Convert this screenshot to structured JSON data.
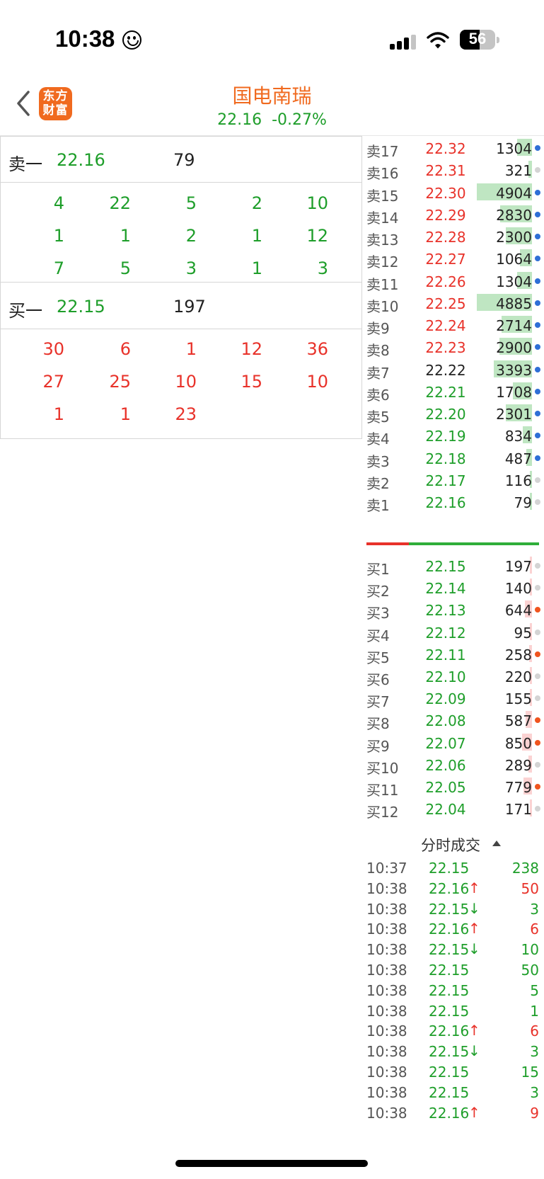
{
  "status_bar": {
    "time": "10:38",
    "battery": "56",
    "battery_level": 0.56,
    "signal_bars": 3
  },
  "header": {
    "logo_line1": "东方",
    "logo_line2": "财富",
    "stock_name": "国电南瑞",
    "price": "22.16",
    "change": "-0.27%"
  },
  "level1": {
    "ask": {
      "label": "卖一",
      "price": "22.16",
      "volume": "79"
    },
    "ask_queue": [
      [
        "4",
        "22",
        "5",
        "2",
        "10"
      ],
      [
        "1",
        "1",
        "2",
        "1",
        "12"
      ],
      [
        "7",
        "5",
        "3",
        "1",
        "3"
      ]
    ],
    "bid": {
      "label": "买一",
      "price": "22.15",
      "volume": "197"
    },
    "bid_queue": [
      [
        "30",
        "6",
        "1",
        "12",
        "36"
      ],
      [
        "27",
        "25",
        "10",
        "15",
        "10"
      ],
      [
        "1",
        "1",
        "23",
        "",
        ""
      ]
    ]
  },
  "order_book": {
    "max_volume": 4904,
    "asks": [
      {
        "label": "卖17",
        "price": "22.32",
        "volume": "1304",
        "color": "red",
        "dot": "blue"
      },
      {
        "label": "卖16",
        "price": "22.31",
        "volume": "321",
        "color": "red",
        "dot": "gray"
      },
      {
        "label": "卖15",
        "price": "22.30",
        "volume": "4904",
        "color": "red",
        "dot": "blue"
      },
      {
        "label": "卖14",
        "price": "22.29",
        "volume": "2830",
        "color": "red",
        "dot": "blue"
      },
      {
        "label": "卖13",
        "price": "22.28",
        "volume": "2300",
        "color": "red",
        "dot": "blue"
      },
      {
        "label": "卖12",
        "price": "22.27",
        "volume": "1064",
        "color": "red",
        "dot": "blue"
      },
      {
        "label": "卖11",
        "price": "22.26",
        "volume": "1304",
        "color": "red",
        "dot": "blue"
      },
      {
        "label": "卖10",
        "price": "22.25",
        "volume": "4885",
        "color": "red",
        "dot": "blue"
      },
      {
        "label": "卖9",
        "price": "22.24",
        "volume": "2714",
        "color": "red",
        "dot": "blue"
      },
      {
        "label": "卖8",
        "price": "22.23",
        "volume": "2900",
        "color": "red",
        "dot": "blue"
      },
      {
        "label": "卖7",
        "price": "22.22",
        "volume": "3393",
        "color": "dark",
        "dot": "blue"
      },
      {
        "label": "卖6",
        "price": "22.21",
        "volume": "1708",
        "color": "green",
        "dot": "blue"
      },
      {
        "label": "卖5",
        "price": "22.20",
        "volume": "2301",
        "color": "green",
        "dot": "blue"
      },
      {
        "label": "卖4",
        "price": "22.19",
        "volume": "834",
        "color": "green",
        "dot": "blue"
      },
      {
        "label": "卖3",
        "price": "22.18",
        "volume": "487",
        "color": "green",
        "dot": "blue"
      },
      {
        "label": "卖2",
        "price": "22.17",
        "volume": "116",
        "color": "green",
        "dot": "gray"
      },
      {
        "label": "卖1",
        "price": "22.16",
        "volume": "79",
        "color": "green",
        "dot": "gray"
      }
    ],
    "bids": [
      {
        "label": "买1",
        "price": "22.15",
        "volume": "197",
        "color": "green",
        "dot": "gray"
      },
      {
        "label": "买2",
        "price": "22.14",
        "volume": "140",
        "color": "green",
        "dot": "gray"
      },
      {
        "label": "买3",
        "price": "22.13",
        "volume": "644",
        "color": "green",
        "dot": "orange"
      },
      {
        "label": "买4",
        "price": "22.12",
        "volume": "95",
        "color": "green",
        "dot": "gray"
      },
      {
        "label": "买5",
        "price": "22.11",
        "volume": "258",
        "color": "green",
        "dot": "orange"
      },
      {
        "label": "买6",
        "price": "22.10",
        "volume": "220",
        "color": "green",
        "dot": "gray"
      },
      {
        "label": "买7",
        "price": "22.09",
        "volume": "155",
        "color": "green",
        "dot": "gray"
      },
      {
        "label": "买8",
        "price": "22.08",
        "volume": "587",
        "color": "green",
        "dot": "orange"
      },
      {
        "label": "买9",
        "price": "22.07",
        "volume": "850",
        "color": "green",
        "dot": "orange"
      },
      {
        "label": "买10",
        "price": "22.06",
        "volume": "289",
        "color": "green",
        "dot": "gray"
      },
      {
        "label": "买11",
        "price": "22.05",
        "volume": "779",
        "color": "green",
        "dot": "orange"
      },
      {
        "label": "买12",
        "price": "22.04",
        "volume": "171",
        "color": "green",
        "dot": "gray"
      }
    ]
  },
  "trades": {
    "title": "分时成交",
    "rows": [
      {
        "time": "10:37",
        "price": "22.15",
        "arrow": "",
        "volume": "238",
        "vol_color": "green"
      },
      {
        "time": "10:38",
        "price": "22.16",
        "arrow": "↑",
        "volume": "50",
        "vol_color": "red"
      },
      {
        "time": "10:38",
        "price": "22.15",
        "arrow": "↓",
        "volume": "3",
        "vol_color": "green"
      },
      {
        "time": "10:38",
        "price": "22.16",
        "arrow": "↑",
        "volume": "6",
        "vol_color": "red"
      },
      {
        "time": "10:38",
        "price": "22.15",
        "arrow": "↓",
        "volume": "10",
        "vol_color": "green"
      },
      {
        "time": "10:38",
        "price": "22.15",
        "arrow": "",
        "volume": "50",
        "vol_color": "green"
      },
      {
        "time": "10:38",
        "price": "22.15",
        "arrow": "",
        "volume": "5",
        "vol_color": "green"
      },
      {
        "time": "10:38",
        "price": "22.15",
        "arrow": "",
        "volume": "1",
        "vol_color": "green"
      },
      {
        "time": "10:38",
        "price": "22.16",
        "arrow": "↑",
        "volume": "6",
        "vol_color": "red"
      },
      {
        "time": "10:38",
        "price": "22.15",
        "arrow": "↓",
        "volume": "3",
        "vol_color": "green"
      },
      {
        "time": "10:38",
        "price": "22.15",
        "arrow": "",
        "volume": "15",
        "vol_color": "green"
      },
      {
        "time": "10:38",
        "price": "22.15",
        "arrow": "",
        "volume": "3",
        "vol_color": "green"
      },
      {
        "time": "10:38",
        "price": "22.16",
        "arrow": "↑",
        "volume": "9",
        "vol_color": "red"
      }
    ]
  },
  "colors": {
    "green": "#1e9e2a",
    "red": "#e8322a",
    "accent": "#f06a1f",
    "dot_blue": "#2f6fd6",
    "dot_orange": "#f0541e",
    "dot_gray": "#d4d4d4"
  }
}
